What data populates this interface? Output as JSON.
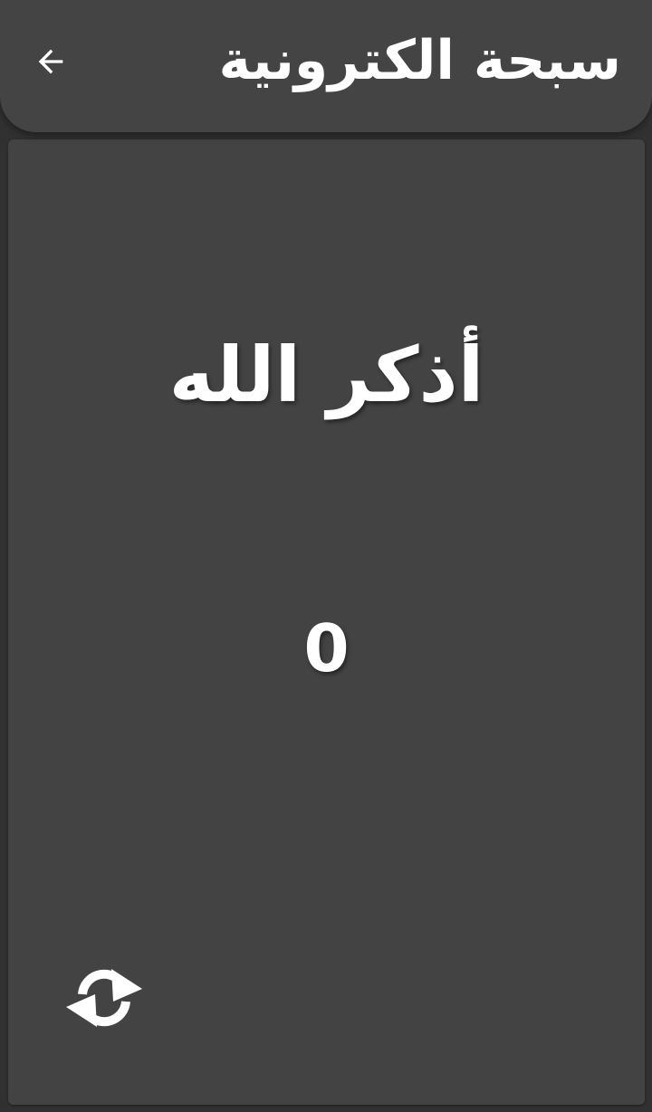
{
  "appbar": {
    "title": "سبحة الكترونية",
    "back_icon": "arrow-left-icon"
  },
  "counter": {
    "dhikr": "أذكر الله",
    "count": "0",
    "reset_icon": "refresh-icon"
  },
  "colors": {
    "background": "#313131",
    "appbar": "#444444",
    "card": "#434343",
    "text": "#ffffff"
  }
}
